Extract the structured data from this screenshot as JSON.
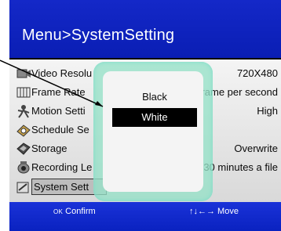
{
  "header": {
    "title": "Menu>SystemSetting"
  },
  "menu": {
    "items": [
      {
        "label": "Video Resolu",
        "value": "720X480",
        "icon": "video-icon"
      },
      {
        "label": "Frame Rate",
        "value": "rame per second",
        "icon": "frame-rate-icon"
      },
      {
        "label": "Motion Setti",
        "value": "High",
        "icon": "motion-icon"
      },
      {
        "label": "Schedule Se",
        "value": "",
        "icon": "schedule-icon"
      },
      {
        "label": "Storage",
        "value": "Overwrite",
        "icon": "storage-icon"
      },
      {
        "label": "Recording Le",
        "value": "30 minutes a file",
        "icon": "recording-icon"
      },
      {
        "label": "System Sett",
        "value": "",
        "icon": "settings-icon"
      }
    ]
  },
  "popup": {
    "options": [
      "Black",
      "White"
    ],
    "selected": "White"
  },
  "footer": {
    "confirm_key": "OK",
    "confirm": "Confirm",
    "move": "↑↓←→ Move"
  },
  "colors": {
    "header": "#0a1eb4",
    "footer": "#1a32d8",
    "popup": "#96e1c8"
  }
}
